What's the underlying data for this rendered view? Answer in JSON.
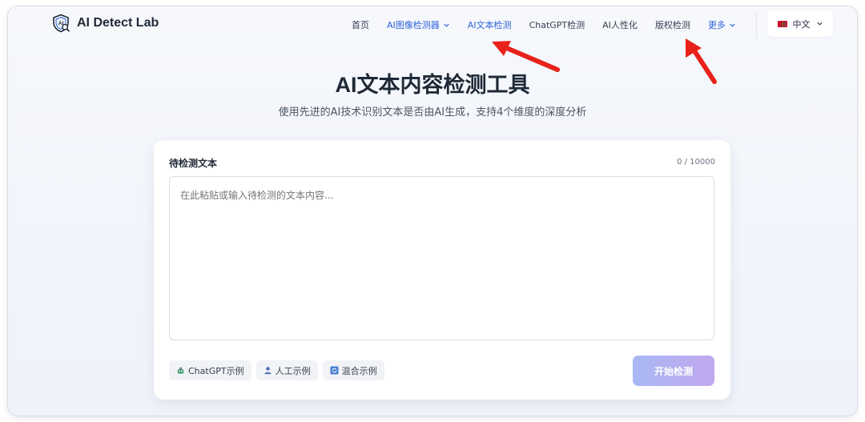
{
  "header": {
    "logo_text": "AI Detect Lab",
    "nav": [
      {
        "label": "首页",
        "active": false
      },
      {
        "label": "AI图像检测器",
        "active": true,
        "dropdown": true
      },
      {
        "label": "AI文本检测",
        "active": true
      },
      {
        "label": "ChatGPT检测",
        "active": false
      },
      {
        "label": "AI人性化",
        "active": false
      },
      {
        "label": "版权检测",
        "active": false
      },
      {
        "label": "更多",
        "active": true,
        "dropdown": true
      }
    ],
    "language": "中文"
  },
  "hero": {
    "title": "AI文本内容检测工具",
    "subtitle": "使用先进的AI技术识别文本是否由AI生成，支持4个维度的深度分析"
  },
  "form": {
    "label": "待检测文本",
    "counter": "0 / 10000",
    "placeholder": "在此粘贴或输入待检测的文本内容...",
    "examples": [
      {
        "label": "ChatGPT示例",
        "icon": "robot-icon"
      },
      {
        "label": "人工示例",
        "icon": "person-icon"
      },
      {
        "label": "混合示例",
        "icon": "refresh-icon"
      }
    ],
    "submit_label": "开始检测"
  },
  "colors": {
    "accent": "#2f62d8",
    "annotation_arrow": "#e8221b",
    "button_gradient_start": "#a9b8f4",
    "button_gradient_end": "#c1a8ef"
  }
}
